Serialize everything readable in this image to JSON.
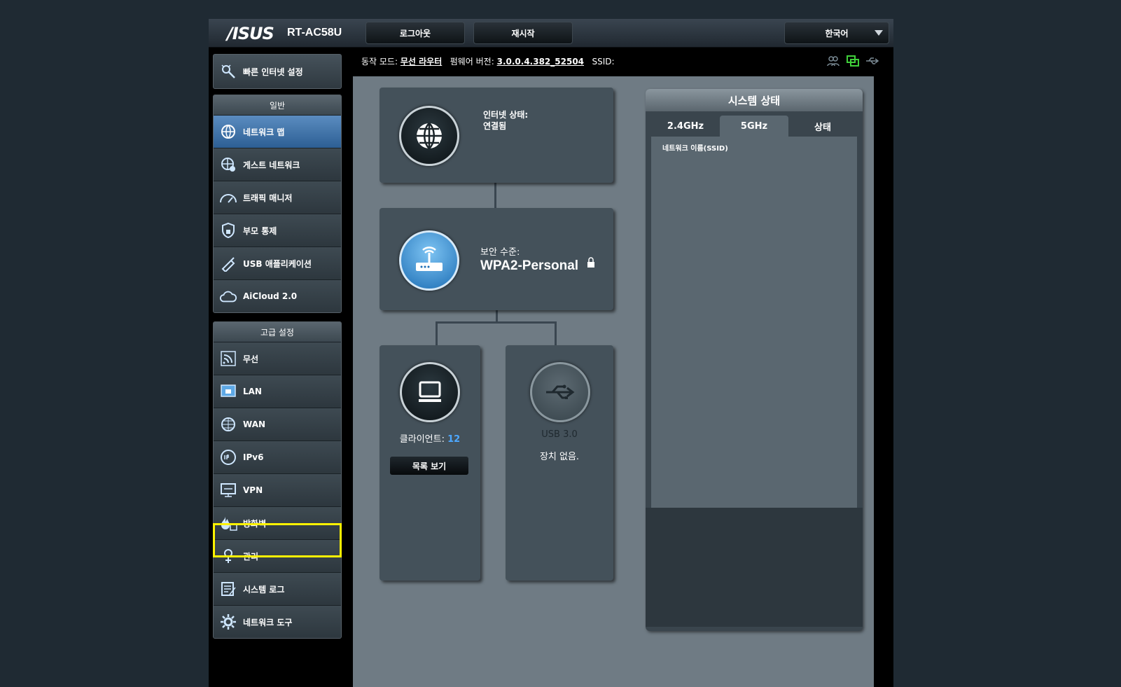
{
  "header": {
    "brand": "/ISUS",
    "model": "RT-AC58U",
    "logout_label": "로그아웃",
    "reboot_label": "재시작",
    "language": "한국어"
  },
  "status": {
    "mode_label": "동작 모드:",
    "mode_value": "무선 라우터",
    "firmware_label": "펌웨어 버전:",
    "firmware_value": "3.0.0.4.382_52504",
    "ssid_label": "SSID:"
  },
  "sidebar": {
    "quick_setup": "빠른 인터넷 설정",
    "general_header": "일반",
    "general_items": [
      {
        "label": "네트워크 맵",
        "icon": "network-map-icon"
      },
      {
        "label": "게스트 네트워크",
        "icon": "guest-network-icon"
      },
      {
        "label": "트래픽 매니저",
        "icon": "traffic-manager-icon"
      },
      {
        "label": "부모 통제",
        "icon": "parental-control-icon"
      },
      {
        "label": "USB 애플리케이션",
        "icon": "usb-app-icon"
      },
      {
        "label": "AiCloud 2.0",
        "icon": "cloud-icon"
      }
    ],
    "advanced_header": "고급 설정",
    "advanced_items": [
      {
        "label": "무선",
        "icon": "wireless-icon"
      },
      {
        "label": "LAN",
        "icon": "lan-icon"
      },
      {
        "label": "WAN",
        "icon": "wan-icon"
      },
      {
        "label": "IPv6",
        "icon": "ipv6-icon"
      },
      {
        "label": "VPN",
        "icon": "vpn-icon"
      },
      {
        "label": "방화벽",
        "icon": "firewall-icon"
      },
      {
        "label": "관리",
        "icon": "admin-icon"
      },
      {
        "label": "시스템 로그",
        "icon": "system-log-icon"
      },
      {
        "label": "네트워크 도구",
        "icon": "network-tools-icon"
      }
    ]
  },
  "map": {
    "internet_status_label": "인터넷 상태:",
    "internet_status_value": "연결됨",
    "security_label": "보안 수준:",
    "security_value": "WPA2-Personal",
    "clients_label": "클라이언트:",
    "clients_count": "12",
    "list_button": "목록 보기",
    "usb_label": "USB 3.0",
    "usb_status": "장치 없음."
  },
  "system_status": {
    "title": "시스템 상태",
    "tabs": [
      "2.4GHz",
      "5GHz",
      "상태"
    ],
    "active_tab": "5GHz",
    "field_ssid": "네트워크 이름(SSID)"
  },
  "colors": {
    "active_item": "#2d5f94",
    "highlight": "#fff200",
    "client_count": "#4da8ff"
  }
}
